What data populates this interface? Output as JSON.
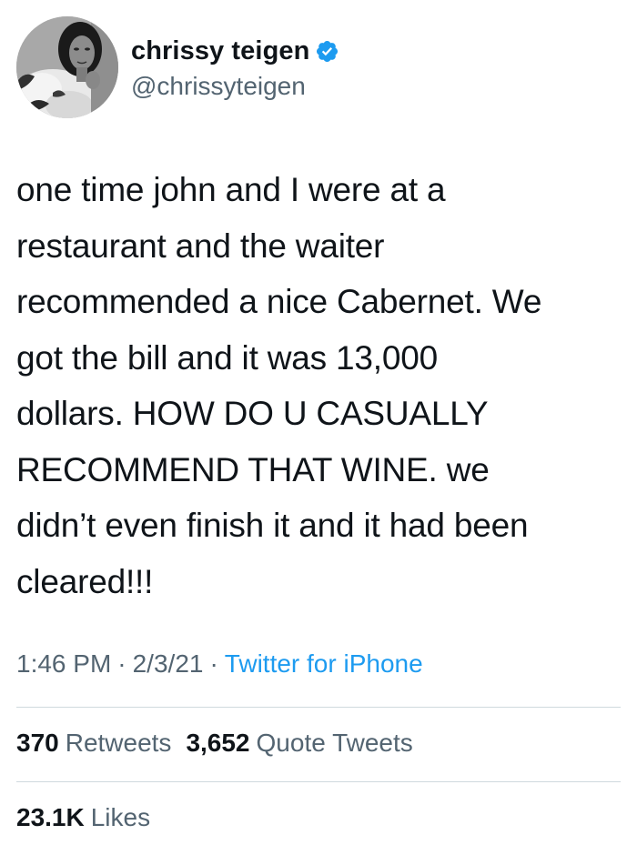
{
  "author": {
    "display_name": "chrissy teigen",
    "handle": "@chrissyteigen",
    "verified": true,
    "avatar_icon": "profile-photo"
  },
  "tweet": {
    "text": "one time john and I were at a\nrestaurant and the waiter\nrecommended a nice Cabernet. We\ngot the bill and it was 13,000\ndollars. HOW DO U CASUALLY\nRECOMMEND THAT WINE. we\ndidn’t even finish it and it had been\ncleared!!!",
    "time": "1:46 PM",
    "date": "2/3/21",
    "source": "Twitter for iPhone",
    "separator": "·"
  },
  "stats": {
    "retweets_count": "370",
    "retweets_label": "Retweets",
    "quote_count": "3,652",
    "quote_label": "Quote Tweets",
    "likes_count": "23.1K",
    "likes_label": "Likes"
  },
  "colors": {
    "text_primary": "#0f1419",
    "text_secondary": "#536471",
    "link": "#1d9bf0",
    "verified_badge": "#1d9bf0",
    "divider": "#cfd9de"
  }
}
